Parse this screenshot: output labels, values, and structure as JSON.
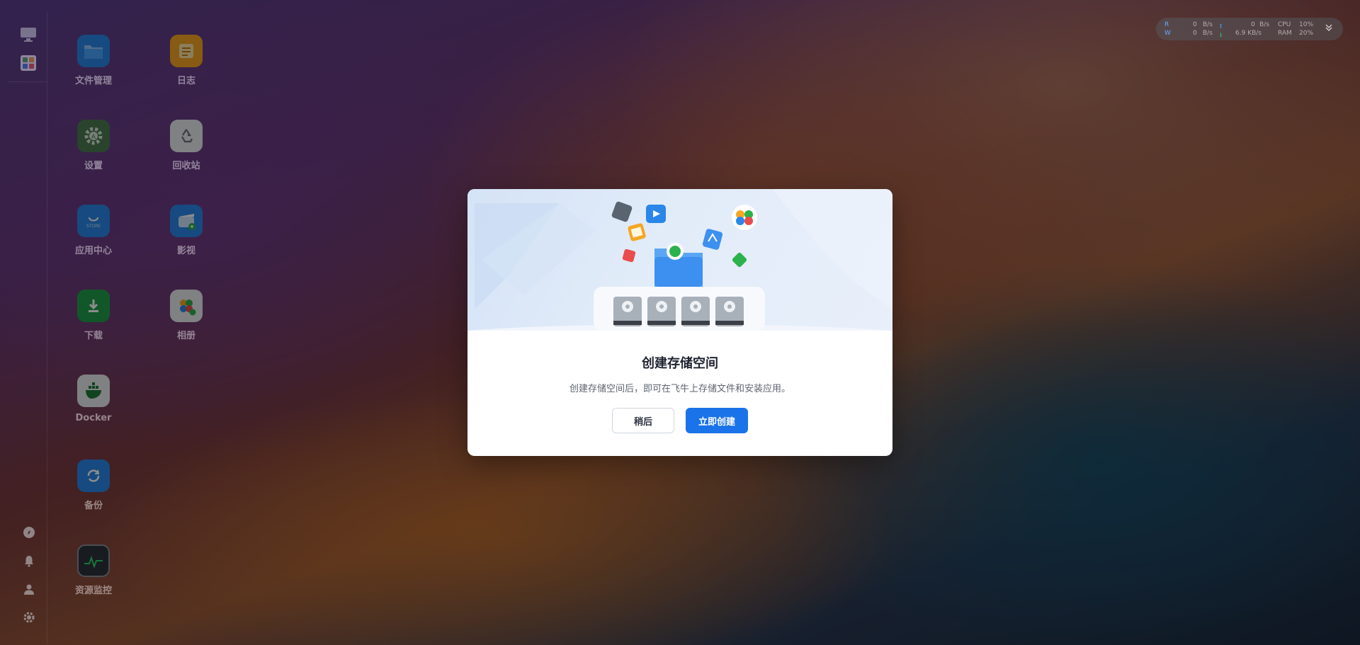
{
  "desktop": {
    "icons": [
      {
        "label": "文件管理",
        "icon": "folder-icon"
      },
      {
        "label": "日志",
        "icon": "log-icon"
      },
      {
        "label": "设置",
        "icon": "settings-icon"
      },
      {
        "label": "回收站",
        "icon": "recycle-bin-icon"
      },
      {
        "label": "应用中心",
        "icon": "store-icon"
      },
      {
        "label": "影视",
        "icon": "video-icon"
      },
      {
        "label": "下载",
        "icon": "download-icon"
      },
      {
        "label": "相册",
        "icon": "photo-album-icon"
      },
      {
        "label": "Docker",
        "icon": "docker-icon"
      },
      {
        "label": "备份",
        "icon": "backup-icon"
      },
      {
        "label": "资源监控",
        "icon": "resource-monitor-icon"
      }
    ]
  },
  "stats": {
    "read_label": "R",
    "write_label": "W",
    "read_speed": "0",
    "read_unit": "B/s",
    "write_speed": "0",
    "write_unit": "B/s",
    "upload_speed": "0",
    "upload_unit": "B/s",
    "download_speed": "6.9 KB/s",
    "cpu_label": "CPU",
    "cpu_value": "10%",
    "ram_label": "RAM",
    "ram_value": "20%"
  },
  "modal": {
    "title": "创建存储空间",
    "description": "创建存储空间后，即可在飞牛上存储文件和安装应用。",
    "later_label": "稍后",
    "create_label": "立即创建"
  },
  "colors": {
    "primary": "#1a73e8",
    "hero_bg": "#dde8f7"
  }
}
